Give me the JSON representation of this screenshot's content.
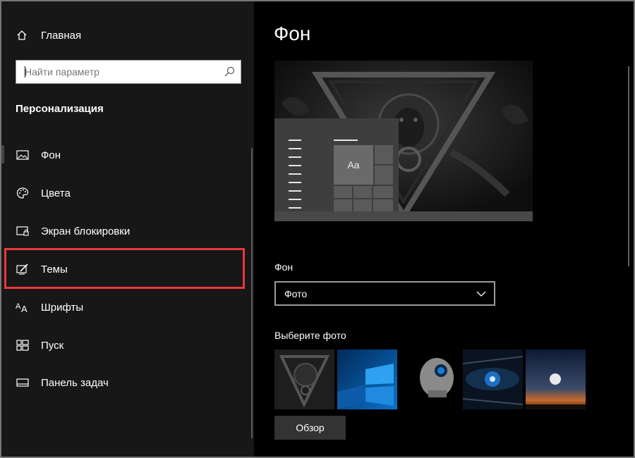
{
  "sidebar": {
    "home_label": "Главная",
    "search_placeholder": "Найти параметр",
    "section_title": "Персонализация",
    "items": [
      {
        "label": "Фон",
        "icon": "picture-icon"
      },
      {
        "label": "Цвета",
        "icon": "palette-icon"
      },
      {
        "label": "Экран блокировки",
        "icon": "lock-screen-icon"
      },
      {
        "label": "Темы",
        "icon": "themes-icon"
      },
      {
        "label": "Шрифты",
        "icon": "fonts-icon"
      },
      {
        "label": "Пуск",
        "icon": "start-icon"
      },
      {
        "label": "Панель задач",
        "icon": "taskbar-icon"
      }
    ],
    "selected_index": 0,
    "highlighted_index": 3
  },
  "main": {
    "title": "Фон",
    "preview_tile_label": "Aa",
    "background_label": "Фон",
    "background_value": "Фото",
    "choose_photo_label": "Выберите фото",
    "browse_label": "Обзор"
  },
  "colors": {
    "sidebar_bg": "#171717",
    "main_bg": "#000000",
    "highlight": "#e8383d",
    "button_bg": "#333333"
  }
}
